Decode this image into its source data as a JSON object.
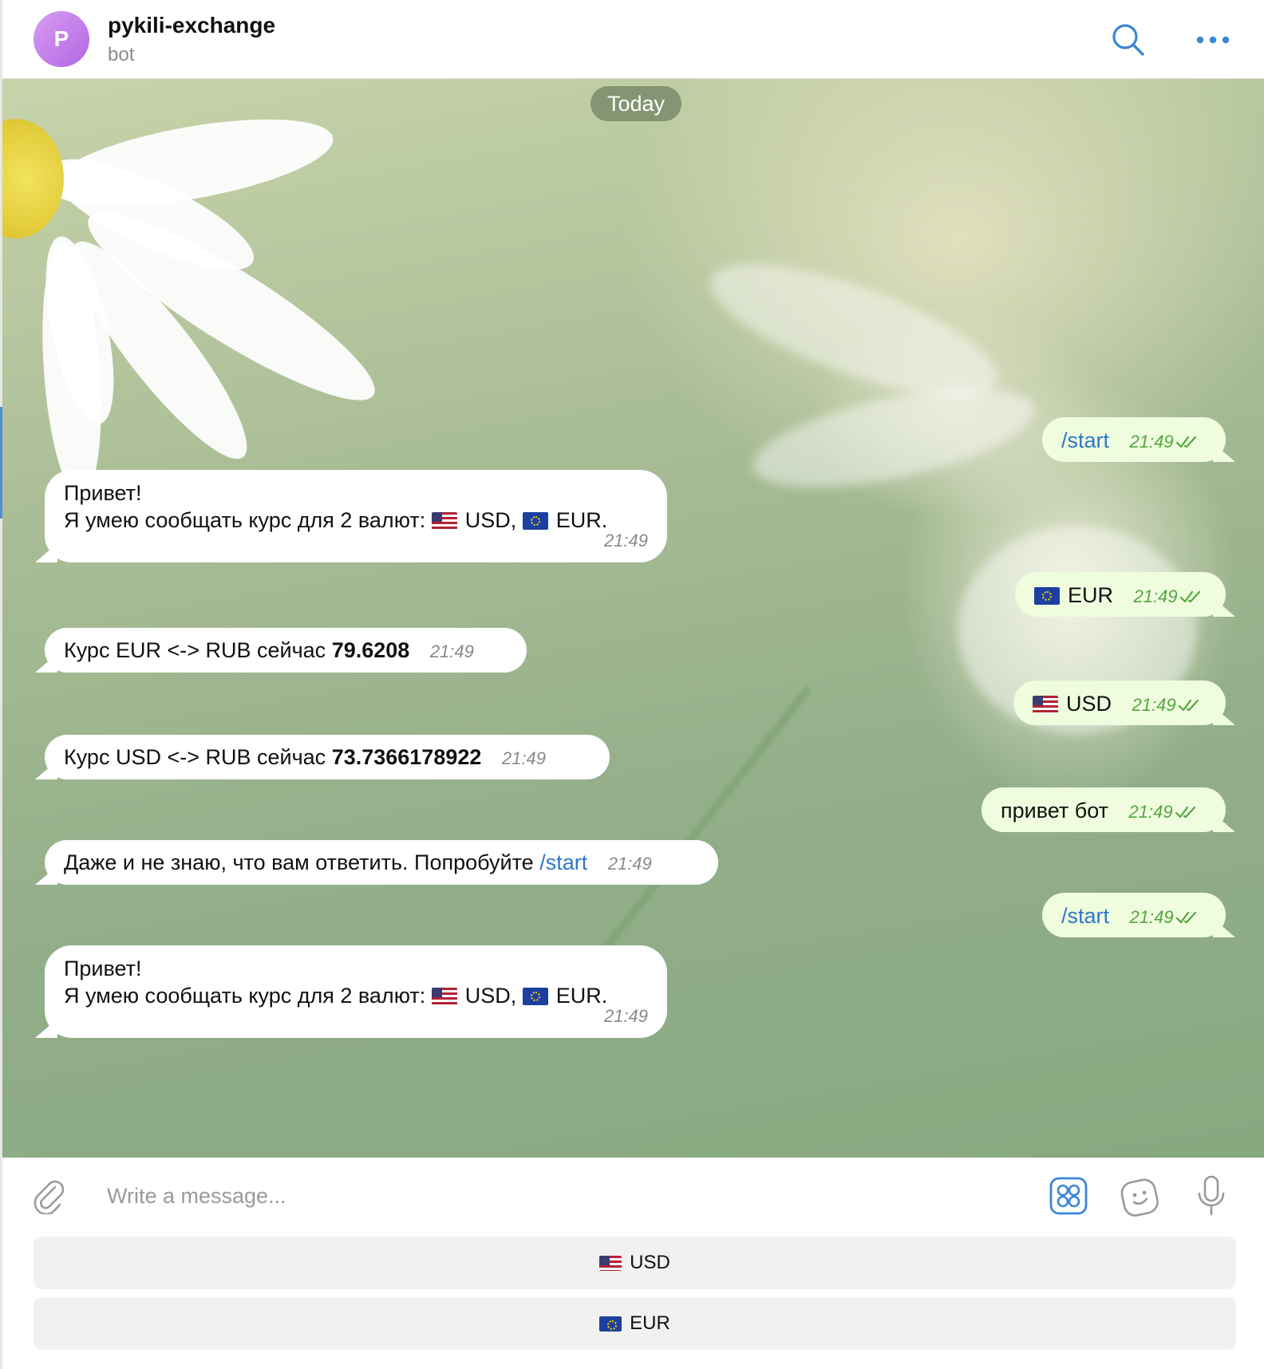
{
  "header": {
    "avatar_letter": "P",
    "title": "pykili-exchange",
    "subtitle": "bot"
  },
  "chat": {
    "date_separator": "Today",
    "messages": [
      {
        "dir": "out",
        "text": "/start",
        "time": "21:49"
      },
      {
        "dir": "in",
        "line1": "Привет!",
        "line2_prefix": "Я умею сообщать курс для 2 валют:",
        "usd": "USD,",
        "eur": "EUR.",
        "time": "21:49"
      },
      {
        "dir": "out",
        "text": "EUR",
        "time": "21:49"
      },
      {
        "dir": "in",
        "prefix": "Курс EUR <-> RUB сейчас",
        "value": "79.6208",
        "time": "21:49"
      },
      {
        "dir": "out",
        "text": "USD",
        "time": "21:49"
      },
      {
        "dir": "in",
        "prefix": "Курс USD <-> RUB сейчас",
        "value": "73.7366178922",
        "time": "21:49"
      },
      {
        "dir": "out",
        "text": "привет бот",
        "time": "21:49"
      },
      {
        "dir": "in",
        "prefix": "Даже и не знаю, что вам ответить. Попробуйте",
        "command": "/start",
        "time": "21:49"
      },
      {
        "dir": "out",
        "text": "/start",
        "time": "21:49"
      },
      {
        "dir": "in",
        "line1": "Привет!",
        "line2_prefix": "Я умею сообщать курс для 2 валют:",
        "usd": "USD,",
        "eur": "EUR.",
        "time": "21:49"
      }
    ]
  },
  "composer": {
    "placeholder": "Write a message..."
  },
  "keyboard": {
    "buttons": [
      {
        "label": "USD",
        "flag": "us-flag"
      },
      {
        "label": "EUR",
        "flag": "eu-flag"
      }
    ]
  },
  "colors": {
    "outgoing_bubble": "#effdde",
    "incoming_bubble": "#ffffff",
    "accent": "#2f78c9",
    "read_checks": "#54a640"
  }
}
